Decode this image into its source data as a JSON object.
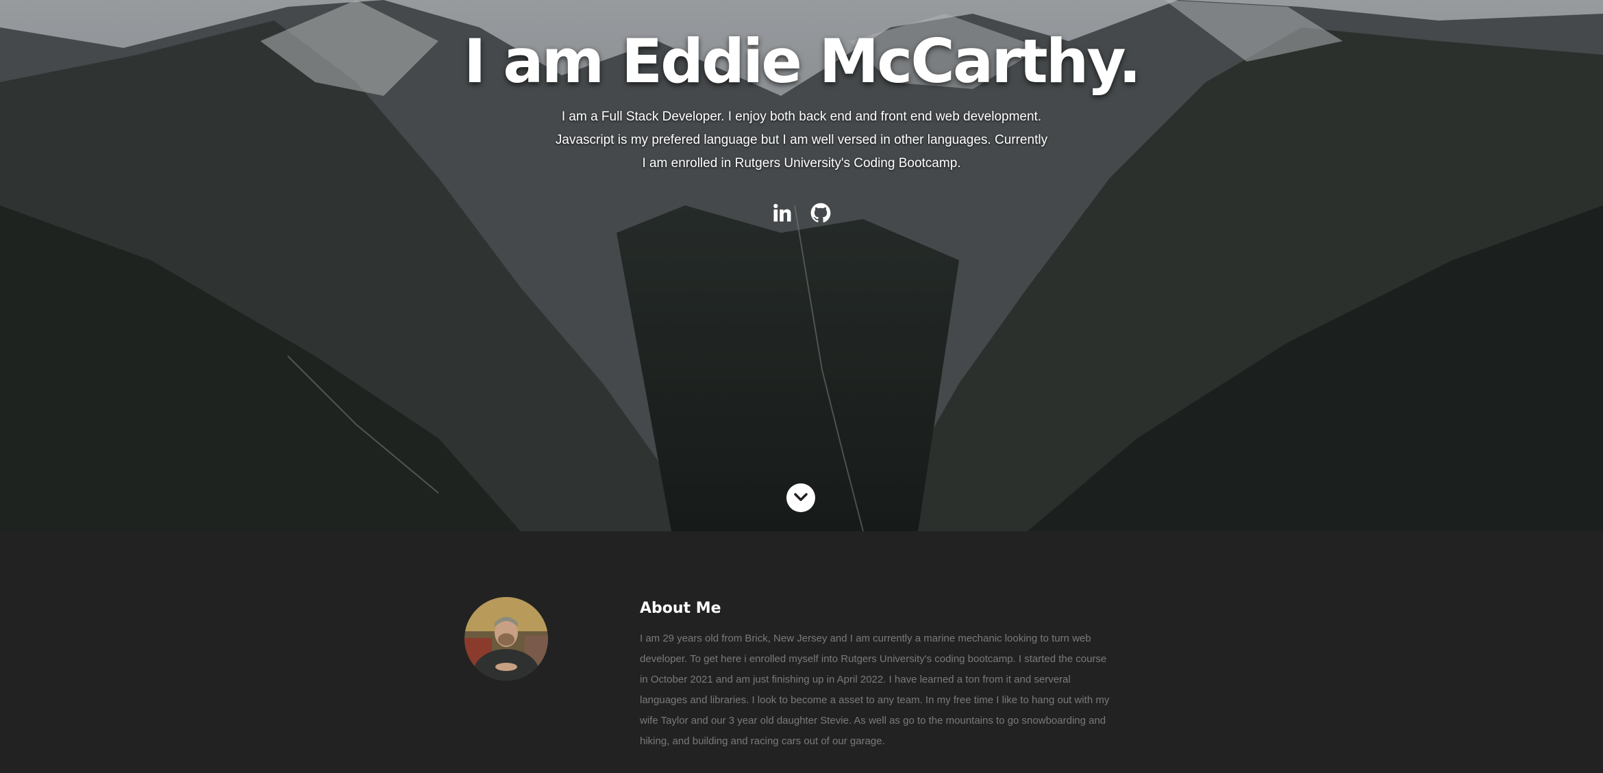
{
  "hero": {
    "title": "I am Eddie McCarthy.",
    "description": "I am a Full Stack Developer. I enjoy both back end and front end web development. Javascript is my prefered language but I am well versed in other languages. Currently I am enrolled in Rutgers University's Coding Bootcamp.",
    "social": [
      {
        "icon": "linkedin-icon"
      },
      {
        "icon": "github-icon"
      }
    ],
    "scroll_icon": "chevron-down-icon"
  },
  "about": {
    "heading": "About Me",
    "text": "I am 29 years old from Brick, New Jersey and I am currently a marine mechanic looking to turn web developer. To get here i enrolled myself into Rutgers University's coding bootcamp. I started the course in October 2021 and am just finishing up in April 2022. I have learned a ton from it and serveral languages and libraries. I look to become a asset to any team. In my free time I like to hang out with my wife Taylor and our 3 year old daughter Stevie. As well as go to the mountains to go snowboarding and hiking, and building and racing cars out of our garage."
  },
  "colors": {
    "background": "#222222",
    "about_text": "#7a7a7a",
    "heading": "#ffffff"
  }
}
